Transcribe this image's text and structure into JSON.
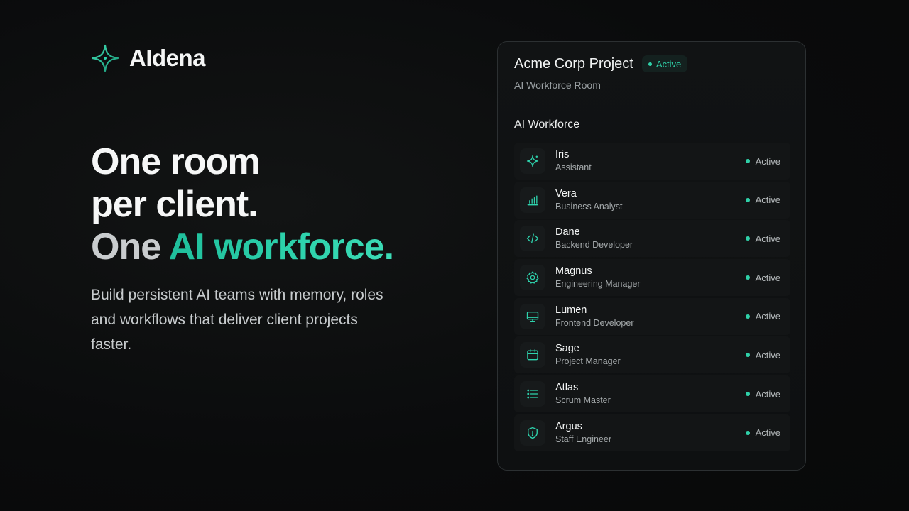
{
  "brand": {
    "name": "AIdena",
    "logo_icon": "sparkle-star-icon",
    "accent": "#2ed3ad"
  },
  "hero": {
    "line1": "One room",
    "line2": "per client.",
    "line3_prefix": "One ",
    "line3_accent": "AI workforce.",
    "subtitle": "Build persistent AI teams with memory, roles and workflows that deliver client projects faster."
  },
  "panel": {
    "title": "Acme Corp Project",
    "status": "Active",
    "subtitle": "AI Workforce Room",
    "section_title": "AI Workforce",
    "agents": [
      {
        "name": "Iris",
        "role": "Assistant",
        "icon": "sparkle-icon",
        "status": "Active"
      },
      {
        "name": "Vera",
        "role": "Business Analyst",
        "icon": "bar-chart-icon",
        "status": "Active"
      },
      {
        "name": "Dane",
        "role": "Backend Developer",
        "icon": "code-icon",
        "status": "Active"
      },
      {
        "name": "Magnus",
        "role": "Engineering Manager",
        "icon": "gear-icon",
        "status": "Active"
      },
      {
        "name": "Lumen",
        "role": "Frontend Developer",
        "icon": "monitor-icon",
        "status": "Active"
      },
      {
        "name": "Sage",
        "role": "Project Manager",
        "icon": "calendar-icon",
        "status": "Active"
      },
      {
        "name": "Atlas",
        "role": "Scrum Master",
        "icon": "list-icon",
        "status": "Active"
      },
      {
        "name": "Argus",
        "role": "Staff Engineer",
        "icon": "shield-icon",
        "status": "Active"
      }
    ]
  }
}
